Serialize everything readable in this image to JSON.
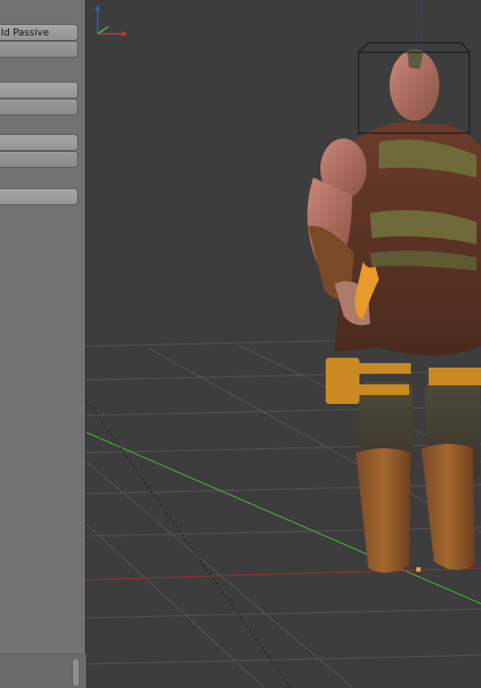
{
  "tool_shelf": {
    "buttons": [
      {
        "label": "ld Passive"
      },
      {
        "label": ""
      },
      {
        "label": ""
      },
      {
        "label": ""
      },
      {
        "label": ""
      },
      {
        "label": ""
      },
      {
        "label": ""
      }
    ]
  },
  "viewport": {
    "axis_colors": {
      "x": "#c23a3a",
      "y": "#4bbd3a",
      "z": "#3a5cc2"
    },
    "grid_color": "#555555",
    "background": "#3d3d3d",
    "selected_object": "character-model",
    "gizmo": {
      "icons": [
        "axis-x",
        "axis-y",
        "axis-z"
      ]
    }
  }
}
